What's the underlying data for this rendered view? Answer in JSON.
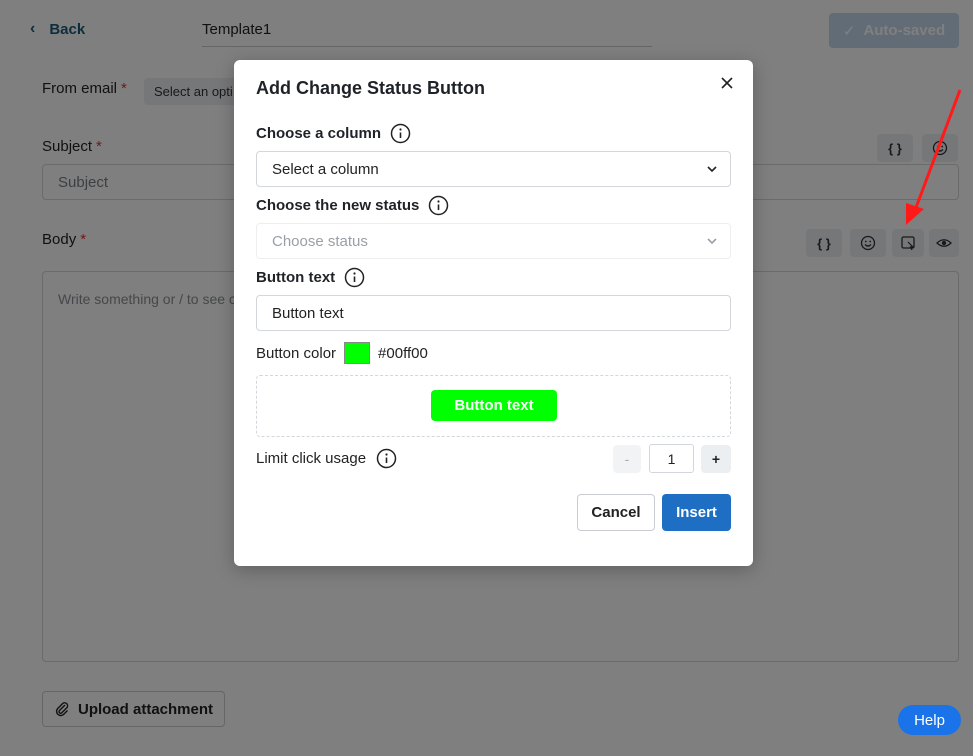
{
  "header": {
    "back_label": "Back",
    "template_name": "Template1",
    "autosaved_label": "Auto-saved"
  },
  "form": {
    "from_email_label": "From email",
    "required_mark": "*",
    "from_email_select": "Select an opti",
    "subject_label": "Subject",
    "subject_placeholder": "Subject",
    "body_label": "Body",
    "body_placeholder": "Write something or / to see c",
    "subject_tools": [
      {
        "icon": "curly-braces-icon",
        "text": "{ }"
      },
      {
        "icon": "emoji-icon"
      }
    ],
    "body_tools": [
      {
        "icon": "curly-braces-icon",
        "text": "{ }"
      },
      {
        "icon": "emoji-icon"
      },
      {
        "icon": "button-insert-icon"
      },
      {
        "icon": "eye-icon"
      }
    ],
    "upload_label": "Upload attachment",
    "help_label": "Help"
  },
  "modal": {
    "title": "Add Change Status Button",
    "column_label": "Choose a column",
    "column_value": "Select a column",
    "status_label": "Choose the new status",
    "status_placeholder": "Choose status",
    "button_text_label": "Button text",
    "button_text_value": "Button text",
    "button_color_label": "Button color",
    "button_color_hex": "#00ff00",
    "preview_button_text": "Button text",
    "limit_label": "Limit click usage",
    "stepper_minus": "-",
    "stepper_value": "1",
    "stepper_plus": "+",
    "cancel_label": "Cancel",
    "insert_label": "Insert"
  },
  "colors": {
    "primary": "#1e6fc3",
    "help": "#1a73e8",
    "preview_button": "#00ff00",
    "annotation_arrow": "#ff1a1a",
    "required": "#e03131"
  }
}
